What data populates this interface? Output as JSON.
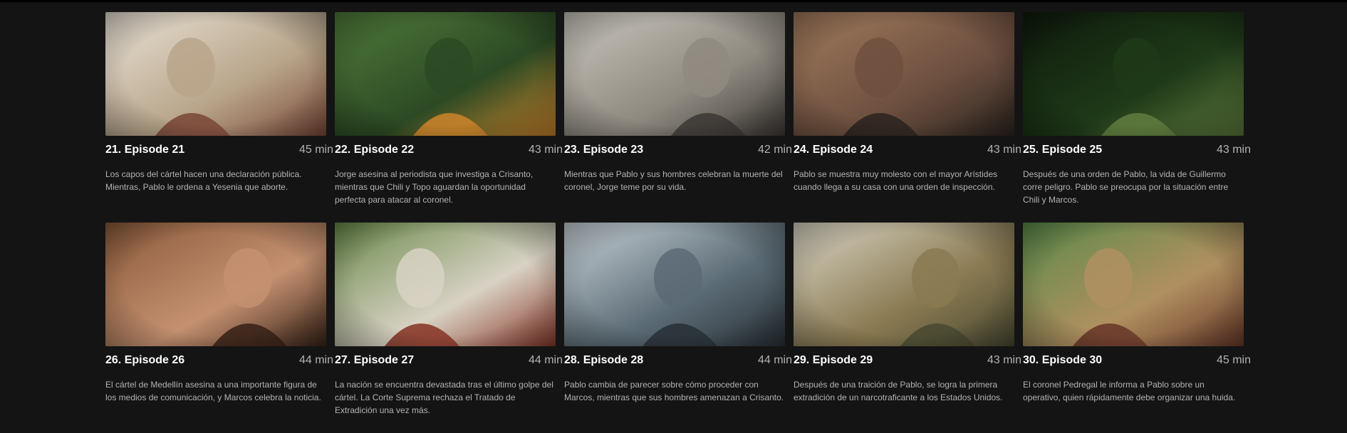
{
  "episodes": [
    {
      "title": "21. Episode 21",
      "duration": "45 min",
      "description": "Los capos del cártel hacen una declaración pública. Mientras, Pablo le ordena a Yesenia que aborte.",
      "palette": [
        "#e9e2d6",
        "#b8a58a",
        "#7c4a3a"
      ]
    },
    {
      "title": "22. Episode 22",
      "duration": "43 min",
      "description": "Jorge asesina al periodista que investiga a Crisanto, mientras que Chili y Topo aguardan la oportunidad perfecta para atacar al coronel.",
      "palette": [
        "#4f7a3a",
        "#2c4a24",
        "#c7822b"
      ]
    },
    {
      "title": "23. Episode 23",
      "duration": "42 min",
      "description": "Mientras que Pablo y sus hombres celebran la muerte del coronel, Jorge teme por su vida.",
      "palette": [
        "#c9c6bd",
        "#8f8a80",
        "#3e3a36"
      ]
    },
    {
      "title": "24. Episode 24",
      "duration": "43 min",
      "description": "Pablo se muestra muy molesto con el mayor Arístides cuando llega a su casa con una orden de inspección.",
      "palette": [
        "#a07a5c",
        "#6e5040",
        "#2d2520"
      ]
    },
    {
      "title": "25. Episode 25",
      "duration": "43 min",
      "description": "Después de una orden de Pablo, la vida de Guillermo corre peligro. Pablo se preocupa por la situación entre Chili y Marcos.",
      "palette": [
        "#0e1a0c",
        "#1f3a18",
        "#5e7a3e"
      ]
    },
    {
      "title": "26. Episode 26",
      "duration": "44 min",
      "description": "El cártel de Medellín asesina a una importante figura de los medios de comunicación, y Marcos celebra la noticia.",
      "palette": [
        "#8a5a3a",
        "#c49070",
        "#3a2418"
      ]
    },
    {
      "title": "27. Episode 27",
      "duration": "44 min",
      "description": "La nación se encuentra devastada tras el último golpe del cártel. La Corte Suprema rechaza el Tratado de Extradición una vez más.",
      "palette": [
        "#6a8a4a",
        "#d8d2c4",
        "#8a3a2a"
      ]
    },
    {
      "title": "28. Episode 28",
      "duration": "44 min",
      "description": "Pablo cambia de parecer sobre cómo proceder con Marcos, mientras que sus hombres amenazan a Crisanto.",
      "palette": [
        "#c8d2d8",
        "#5a6a74",
        "#2a3238"
      ]
    },
    {
      "title": "29. Episode 29",
      "duration": "43 min",
      "description": "Después de una traición de Pablo, se logra la primera extradición de un narcotraficante a los Estados Unidos.",
      "palette": [
        "#d8d4c4",
        "#8a7a52",
        "#4a4a32"
      ]
    },
    {
      "title": "30. Episode 30",
      "duration": "45 min",
      "description": "El coronel Pedregal le informa a Pablo sobre un operativo, quien rápidamente debe organizar una huida.",
      "palette": [
        "#5a8a4a",
        "#b09060",
        "#6a3a2a"
      ]
    }
  ]
}
